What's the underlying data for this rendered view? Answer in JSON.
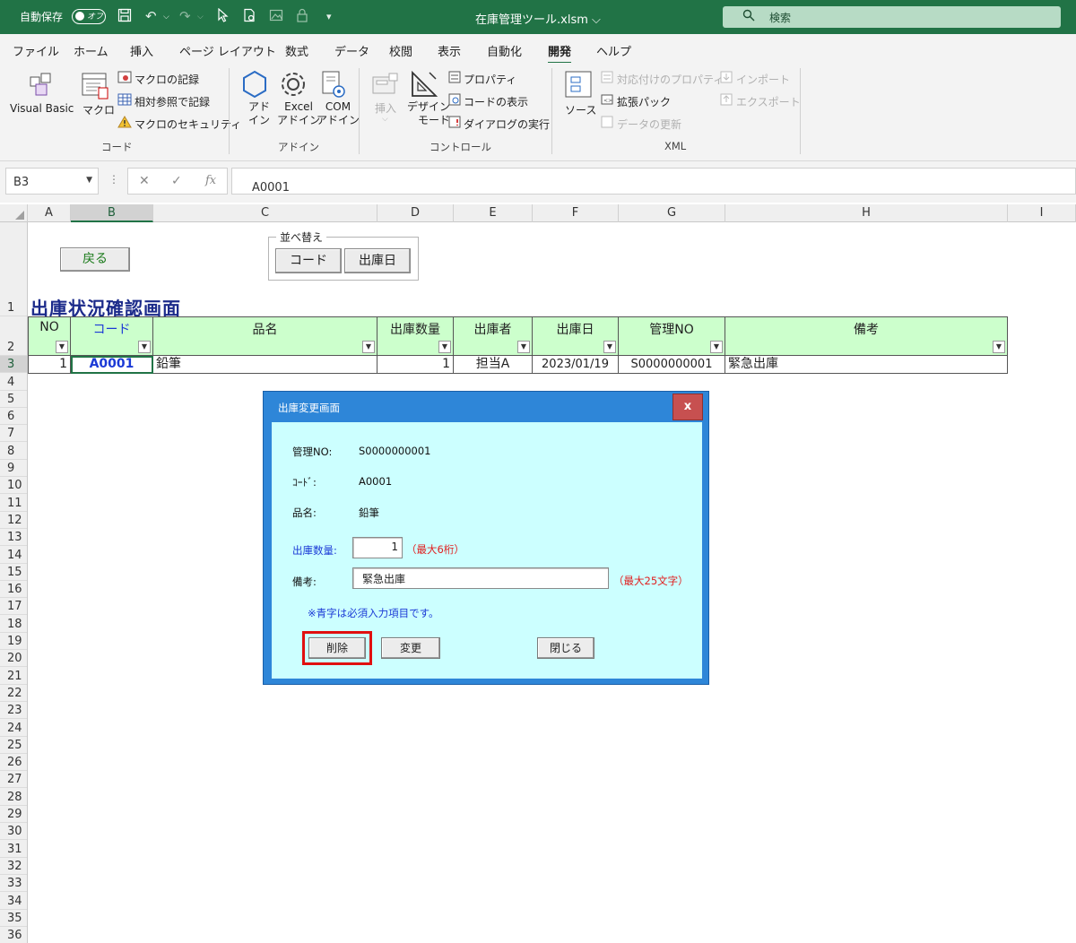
{
  "titlebar": {
    "autosave_label": "自動保存",
    "autosave_state": "オフ",
    "filename": "在庫管理ツール.xlsm",
    "filename_chevron": "⌵",
    "search_placeholder": "検索",
    "accent_color": "#217346"
  },
  "ribbon_tabs": [
    "ファイル",
    "ホーム",
    "挿入",
    "ページ レイアウト",
    "数式",
    "データ",
    "校閲",
    "表示",
    "自動化",
    "開発",
    "ヘルプ"
  ],
  "active_tab": "開発",
  "ribbon": {
    "code": {
      "group_label": "コード",
      "visual_basic": "Visual Basic",
      "macro": "マクロ",
      "record_macro": "マクロの記録",
      "relative_ref": "相対参照で記録",
      "macro_security": "マクロのセキュリティ"
    },
    "addins": {
      "group_label": "アドイン",
      "addin_line1": "アド",
      "addin_line2": "イン",
      "excel_addin_line1": "Excel",
      "excel_addin_line2": "アドイン",
      "com_addin_line1": "COM",
      "com_addin_line2": "アドイン"
    },
    "controls": {
      "group_label": "コントロール",
      "insert": "挿入",
      "design_mode_line1": "デザイン",
      "design_mode_line2": "モード",
      "properties": "プロパティ",
      "view_code": "コードの表示",
      "run_dialog": "ダイアログの実行"
    },
    "xml": {
      "group_label": "XML",
      "source": "ソース",
      "map_properties": "対応付けのプロパティ",
      "expansion_packs": "拡張パック",
      "refresh_data": "データの更新",
      "import": "インポート",
      "export": "エクスポート"
    }
  },
  "formula_bar": {
    "name_box": "B3",
    "fx_label": "fx",
    "cancel_glyph": "✕",
    "enter_glyph": "✓",
    "value": "A0001"
  },
  "columns": [
    "A",
    "B",
    "C",
    "D",
    "E",
    "F",
    "G",
    "H",
    "I"
  ],
  "rows": [
    "1",
    "2",
    "3",
    "4",
    "5",
    "6",
    "7",
    "8",
    "9",
    "10",
    "11",
    "12",
    "13",
    "14",
    "15",
    "16",
    "17",
    "18",
    "19",
    "20",
    "21",
    "22",
    "23",
    "24",
    "25",
    "26",
    "27",
    "28",
    "29",
    "30",
    "31",
    "32",
    "33",
    "34",
    "35",
    "36"
  ],
  "sheet": {
    "back_button": "戻る",
    "sort_group_label": "並べ替え",
    "sort_code_button": "コード",
    "sort_date_button": "出庫日",
    "title": "出庫状況確認画面",
    "headers": [
      "NO",
      "コード",
      "品名",
      "出庫数量",
      "出庫者",
      "出庫日",
      "管理NO",
      "備考"
    ],
    "row": [
      "1",
      "A0001",
      "鉛筆",
      "1",
      "担当A",
      "2023/01/19",
      "S0000000001",
      "緊急出庫"
    ],
    "header_bg": "#ccffcc",
    "title_color": "#1b2a8a"
  },
  "dialog": {
    "title": "出庫変更画面",
    "close_glyph": "x",
    "mgmt_no_label": "管理NO:",
    "mgmt_no_value": "S0000000001",
    "code_label": "ｺｰﾄﾞ:",
    "code_value": "A0001",
    "item_label": "品名:",
    "item_value": "鉛筆",
    "qty_label": "出庫数量:",
    "qty_value": "1",
    "qty_hint": "（最大6桁）",
    "note_label": "備考:",
    "note_value": "緊急出庫",
    "note_hint": "（最大25文字）",
    "required_note": "※青字は必須入力項目です。",
    "delete_button": "削除",
    "change_button": "変更",
    "close_button": "閉じる",
    "bg_color": "#ccffff",
    "frame_color": "#2e86d8"
  }
}
